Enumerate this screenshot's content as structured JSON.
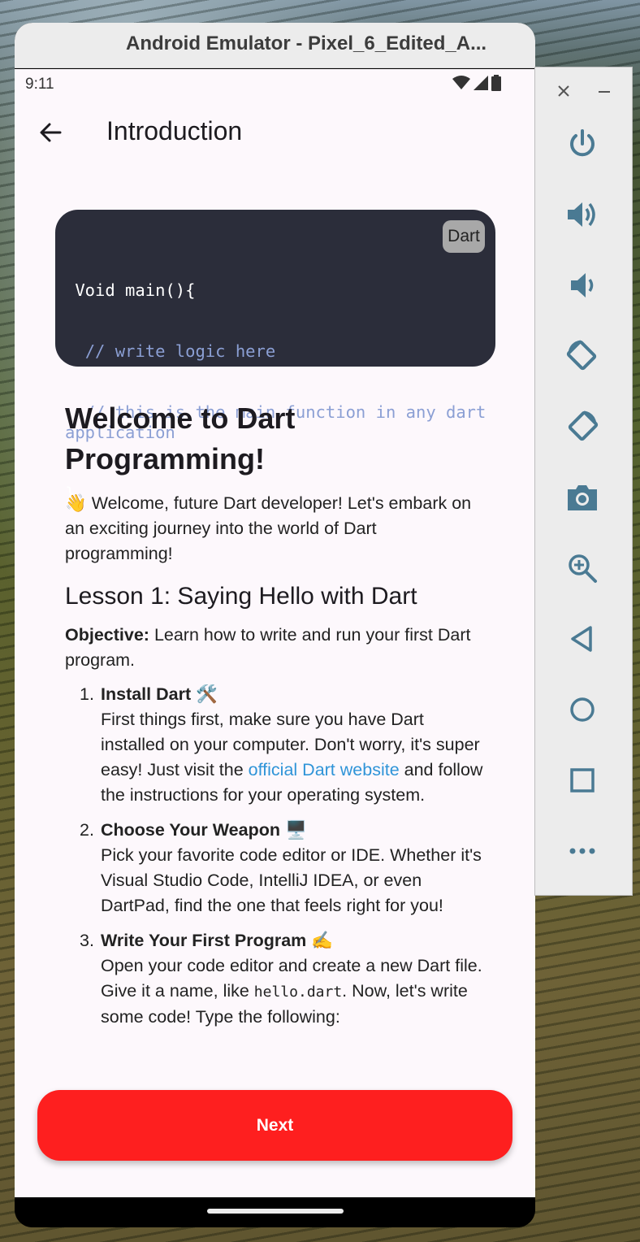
{
  "window": {
    "title": "Android Emulator - Pixel_6_Edited_A..."
  },
  "status_bar": {
    "time": "9:11"
  },
  "app_bar": {
    "title": "Introduction"
  },
  "code_block": {
    "language": "Dart",
    "lines": [
      {
        "text": " Void main(){",
        "type": "code"
      },
      {
        "text": "  // write logic here",
        "type": "comment"
      },
      {
        "text": "  // this is the main function in any dart application",
        "type": "comment"
      },
      {
        "text": "}",
        "type": "code"
      }
    ]
  },
  "content": {
    "heading": "Welcome to Dart Programming!",
    "intro_emoji": "👋",
    "intro": "Welcome, future Dart developer! Let's embark on an exciting journey into the world of Dart programming!",
    "lesson_title": "Lesson 1: Saying Hello with Dart",
    "objective_label": "Objective:",
    "objective_text": "Learn how to write and run your first Dart program.",
    "steps": [
      {
        "number": "1.",
        "title": "Install Dart 🛠️",
        "text_before_link": "First things first, make sure you have Dart installed on your computer. Don't worry, it's super easy! Just visit the ",
        "link_text": "official Dart website",
        "text_after_link": " and follow the instructions for your operating system."
      },
      {
        "number": "2.",
        "title": "Choose Your Weapon 🖥️",
        "text": "Pick your favorite code editor or IDE. Whether it's Visual Studio Code, IntelliJ IDEA, or even DartPad, find the one that feels right for you!"
      },
      {
        "number": "3.",
        "title": "Write Your First Program ✍️",
        "text_before_code": "Open your code editor and create a new Dart file. Give it a name, like ",
        "code": "hello.dart",
        "text_after_code": ". Now, let's write some code! Type the following:"
      }
    ]
  },
  "next_button": {
    "label": "Next"
  },
  "colors": {
    "accent_red": "#fe1f1f",
    "link_blue": "#2f94d8",
    "code_bg": "#2b2d3a",
    "code_comment": "#8b9fd4"
  },
  "side_toolbar": {
    "icons": [
      "close-icon",
      "minimize-icon",
      "power-icon",
      "volume-up-icon",
      "volume-down-icon",
      "rotate-left-icon",
      "rotate-right-icon",
      "camera-icon",
      "zoom-icon",
      "back-icon",
      "home-icon",
      "overview-icon",
      "more-icon"
    ]
  }
}
